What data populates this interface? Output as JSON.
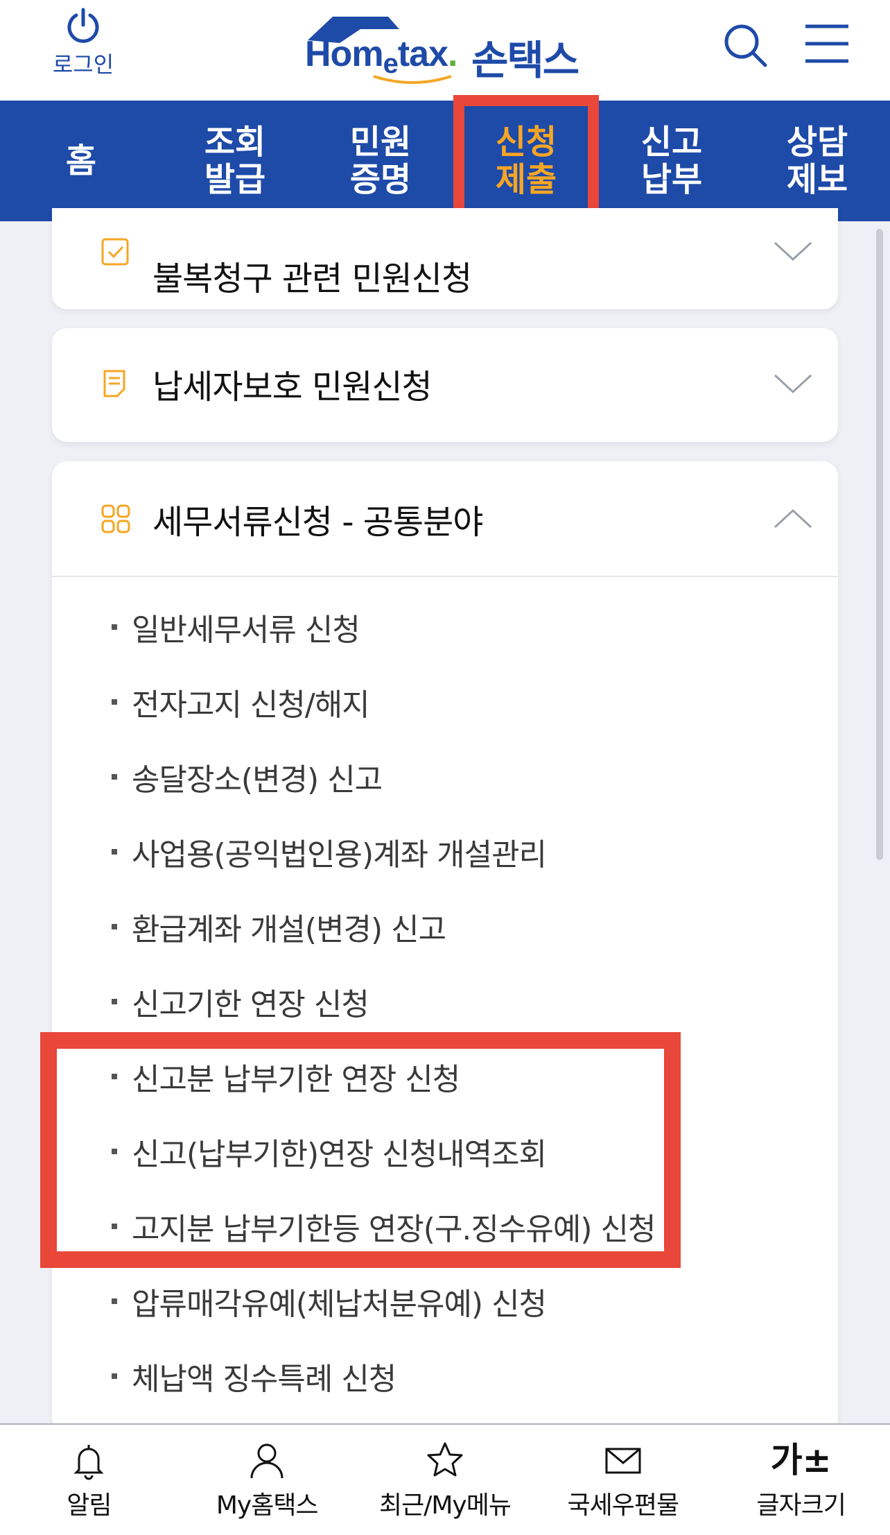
{
  "header": {
    "login_label": "로그인",
    "logo_text_1": "Hom",
    "logo_text_2": "e",
    "logo_text_3": "tax",
    "logo_dot": ".",
    "logo_kr": "손택스"
  },
  "nav": {
    "items": [
      {
        "line1": "홈",
        "line2": ""
      },
      {
        "line1": "조회",
        "line2": "발급"
      },
      {
        "line1": "민원",
        "line2": "증명"
      },
      {
        "line1": "신청",
        "line2": "제출"
      },
      {
        "line1": "신고",
        "line2": "납부"
      },
      {
        "line1": "상담",
        "line2": "제보"
      }
    ],
    "active_index": 3
  },
  "cards": {
    "objection": {
      "title": "불복청구 관련 민원신청",
      "icon": "checkbox-icon",
      "expanded": false
    },
    "taxpayer_protection": {
      "title": "납세자보호 민원신청",
      "icon": "document-icon",
      "expanded": false
    },
    "tax_documents": {
      "title": "세무서류신청 - 공통분야",
      "icon": "grid-icon",
      "expanded": true,
      "items": [
        "일반세무서류 신청",
        "전자고지 신청/해지",
        "송달장소(변경) 신고",
        "사업용(공익법인용)계좌 개설관리",
        "환급계좌 개설(변경) 신고",
        "신고기한 연장 신청",
        "신고분 납부기한 연장 신청",
        "신고(납부기한)연장 신청내역조회",
        "고지분 납부기한등 연장(구.징수유예) 신청",
        "압류매각유예(체납처분유예) 신청",
        "체납액 징수특례 신청"
      ]
    }
  },
  "bottom_bar": {
    "tabs": [
      {
        "label": "알림",
        "icon": "bell-icon"
      },
      {
        "label": "My홈택스",
        "icon": "person-icon"
      },
      {
        "label": "최근/My메뉴",
        "icon": "star-icon"
      },
      {
        "label": "국세우편물",
        "icon": "envelope-icon"
      },
      {
        "label": "글자크기",
        "icon": "font-size-icon",
        "glyph": "가±"
      }
    ]
  },
  "colors": {
    "brand_blue": "#1e4aa8",
    "active_orange": "#f6a623",
    "highlight_red": "#e8473a"
  }
}
